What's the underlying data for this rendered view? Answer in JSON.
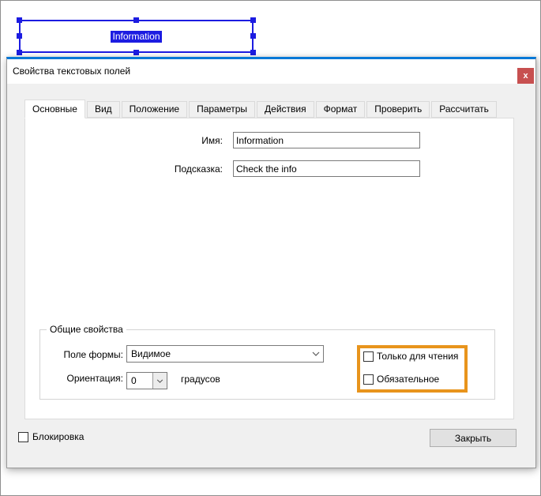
{
  "field_annotation": {
    "text": "Information"
  },
  "dialog": {
    "title": "Свойства текстовых полей",
    "close_icon": "x",
    "tabs": [
      {
        "label": "Основные",
        "active": true
      },
      {
        "label": "Вид",
        "active": false
      },
      {
        "label": "Положение",
        "active": false
      },
      {
        "label": "Параметры",
        "active": false
      },
      {
        "label": "Действия",
        "active": false
      },
      {
        "label": "Формат",
        "active": false
      },
      {
        "label": "Проверить",
        "active": false
      },
      {
        "label": "Рассчитать",
        "active": false
      }
    ],
    "general": {
      "name_label": "Имя:",
      "name_value": "Information",
      "tooltip_label": "Подсказка:",
      "tooltip_value": "Check the info",
      "group_title": "Общие свойства",
      "form_field_label": "Поле формы:",
      "form_field_value": "Видимое",
      "orientation_label": "Ориентация:",
      "orientation_value": "0",
      "degrees_suffix": "градусов",
      "readonly_label": "Только для чтения",
      "readonly_checked": false,
      "required_label": "Обязательное",
      "required_checked": false
    },
    "lock_label": "Блокировка",
    "lock_checked": false,
    "close_button_label": "Закрыть"
  },
  "colors": {
    "accent_blue": "#0078d7",
    "selection_blue": "#1c1ce1",
    "close_button_red": "#c75050",
    "highlight_orange": "#e8941c"
  }
}
